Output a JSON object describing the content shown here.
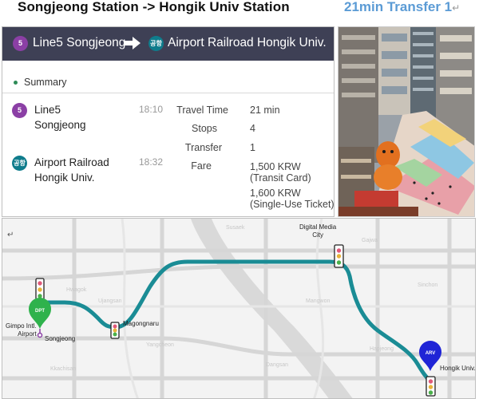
{
  "headline": {
    "route": "Songjeong Station -> Hongik Univ Station",
    "meta": "21min Transfer 1",
    "return_mark": "↵"
  },
  "route_bar": {
    "origin_badge": "5",
    "origin": "Line5 Songjeong",
    "dest_badge": "공항",
    "destination": "Airport Railroad Hongik Univ."
  },
  "summary": {
    "title": "Summary",
    "stops": [
      {
        "badge": "5",
        "name": "Line5\nSongjeong",
        "time": "18:10"
      },
      {
        "badge": "공항",
        "name": "Airport Railroad\nHongik Univ.",
        "time": "18:32"
      }
    ],
    "labels": {
      "travel_time": "Travel Time",
      "stops": "Stops",
      "transfer": "Transfer",
      "fare": "Fare"
    },
    "values": {
      "travel_time": "21 min",
      "stops": "4",
      "transfer": "1",
      "fare_card": "1,500 KRW",
      "fare_card_note": "(Transit Card)",
      "fare_single": "1,600 KRW",
      "fare_single_note": "(Single-Use Ticket)"
    }
  },
  "map": {
    "return_mark": "↵",
    "stations": {
      "dmc": "Digital Media\nCity",
      "magongnaru": "Magongnaru",
      "gimpo": "Gimpo Intl.\nAirport",
      "songjeong": "Songjeong",
      "hongik": "Hongik Univ."
    },
    "pins": {
      "departure": "DPT",
      "arrival": "ARV"
    }
  },
  "colors": {
    "line5": "#8b3fa5",
    "airport_railroad": "#0f7c8c",
    "route_path": "#1a8c95",
    "departure_pin": "#2fb24c",
    "arrival_pin": "#1f24d6",
    "river": "#d5d5d5"
  }
}
